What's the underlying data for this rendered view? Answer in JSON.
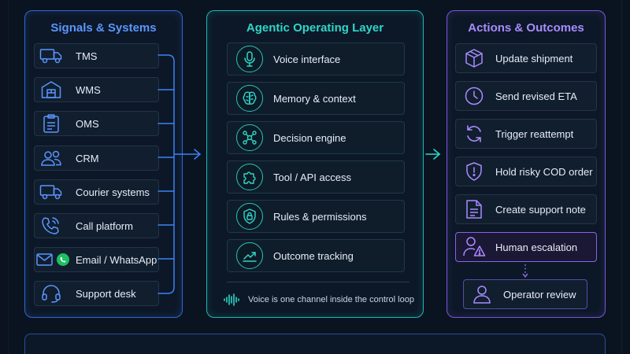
{
  "colors": {
    "signals_accent": "#3b82f6",
    "agentic_accent": "#1fb8b0",
    "actions_accent": "#7b55d8",
    "background": "#0b1220"
  },
  "signals": {
    "title": "Signals & Systems",
    "items": [
      {
        "label": "TMS",
        "icon": "truck-icon"
      },
      {
        "label": "WMS",
        "icon": "warehouse-icon"
      },
      {
        "label": "OMS",
        "icon": "clipboard-icon"
      },
      {
        "label": "CRM",
        "icon": "users-icon"
      },
      {
        "label": "Courier systems",
        "icon": "courier-truck-icon"
      },
      {
        "label": "Call platform",
        "icon": "phone-icon"
      },
      {
        "label": "Email / WhatsApp",
        "icon": "email-whatsapp-icon"
      },
      {
        "label": "Support desk",
        "icon": "headset-icon"
      }
    ]
  },
  "agentic": {
    "title": "Agentic Operating Layer",
    "items": [
      {
        "label": "Voice interface",
        "icon": "microphone-icon"
      },
      {
        "label": "Memory & context",
        "icon": "brain-icon"
      },
      {
        "label": "Decision engine",
        "icon": "network-icon"
      },
      {
        "label": "Tool / API access",
        "icon": "puzzle-icon"
      },
      {
        "label": "Rules & permissions",
        "icon": "shield-lock-icon"
      },
      {
        "label": "Outcome tracking",
        "icon": "trend-chart-icon"
      }
    ],
    "footnote": "Voice is one channel inside the control loop"
  },
  "actions": {
    "title": "Actions & Outcomes",
    "items": [
      {
        "label": "Update shipment",
        "icon": "package-icon"
      },
      {
        "label": "Send revised ETA",
        "icon": "clock-icon"
      },
      {
        "label": "Trigger reattempt",
        "icon": "refresh-icon"
      },
      {
        "label": "Hold risky COD order",
        "icon": "shield-alert-icon"
      },
      {
        "label": "Create support note",
        "icon": "document-icon"
      },
      {
        "label": "Human escalation",
        "icon": "user-warning-icon"
      }
    ],
    "review": {
      "label": "Operator review",
      "icon": "user-icon"
    }
  }
}
